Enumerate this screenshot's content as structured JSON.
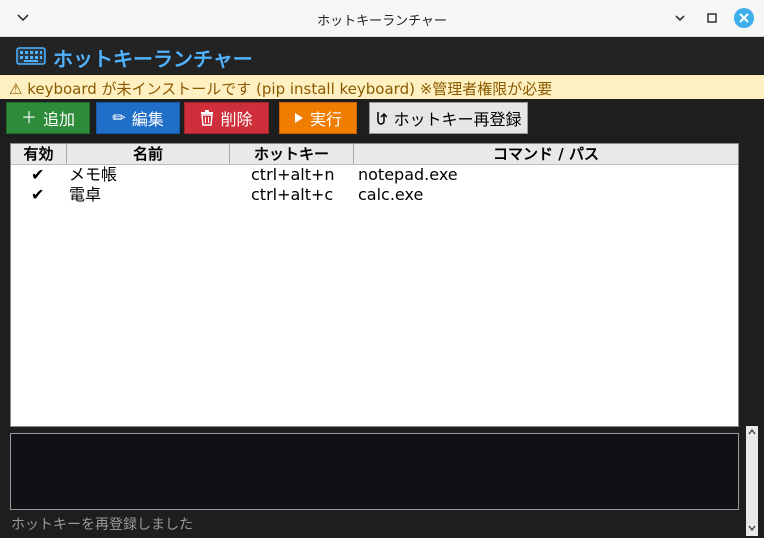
{
  "window": {
    "title": "ホットキーランチャー"
  },
  "header": {
    "title": "ホットキーランチャー"
  },
  "warning": {
    "text": "⚠ keyboard が未インストールです (pip install keyboard) ※管理者権限が必要"
  },
  "toolbar": {
    "add_label": "追加",
    "edit_label": "編集",
    "delete_label": "削除",
    "run_label": "実行",
    "reregister_label": "ホットキー再登録"
  },
  "table": {
    "columns": [
      "有効",
      "名前",
      "ホットキー",
      "コマンド / パス"
    ],
    "rows": [
      {
        "enabled": "✔",
        "name": "メモ帳",
        "hotkey": "ctrl+alt+n",
        "command": "notepad.exe"
      },
      {
        "enabled": "✔",
        "name": "電卓",
        "hotkey": "ctrl+alt+c",
        "command": "calc.exe"
      }
    ]
  },
  "status": {
    "text": "ホットキーを再登録しました"
  },
  "icons": {
    "app": "keyboard-icon",
    "add": "plus-icon",
    "edit": "pencil-icon",
    "delete": "trash-icon",
    "run": "play-icon",
    "reregister": "refresh-icon"
  },
  "colors": {
    "accent": "#4fb3ff",
    "add": "#2e8b3a",
    "edit": "#1f6ec8",
    "delete": "#cf2f3a",
    "run": "#f07d00",
    "warning_bg": "#fff0c2",
    "warning_text": "#8a5a00"
  }
}
